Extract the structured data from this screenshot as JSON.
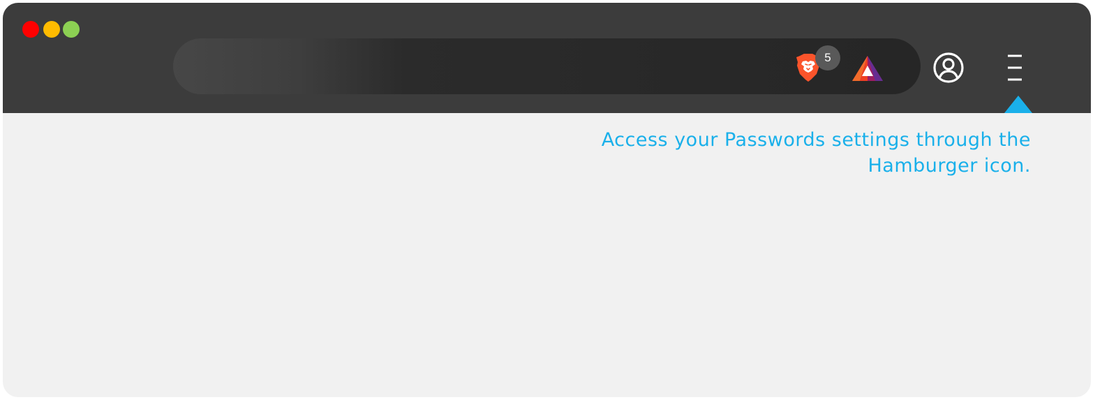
{
  "window": {
    "traffic_lights": {
      "close_color": "#ff0000",
      "minimize_color": "#ffbb00",
      "zoom_color": "#8cd053"
    }
  },
  "toolbar": {
    "address_bar": {
      "value": ""
    },
    "shields": {
      "icon": "brave-lion-icon",
      "badge_count": "5"
    },
    "rewards": {
      "icon": "bat-triangle-icon"
    },
    "profile": {
      "icon": "user-circle-icon"
    },
    "menu": {
      "icon": "hamburger-menu-icon"
    }
  },
  "hint": {
    "text": "Access your Passwords settings through the Hamburger icon.",
    "color": "#1ab0ea"
  },
  "colors": {
    "toolbar_bg": "#3c3c3c",
    "content_bg": "#f1f1f1",
    "accent": "#1ab0ea",
    "brave_orange": "#fb542b"
  }
}
